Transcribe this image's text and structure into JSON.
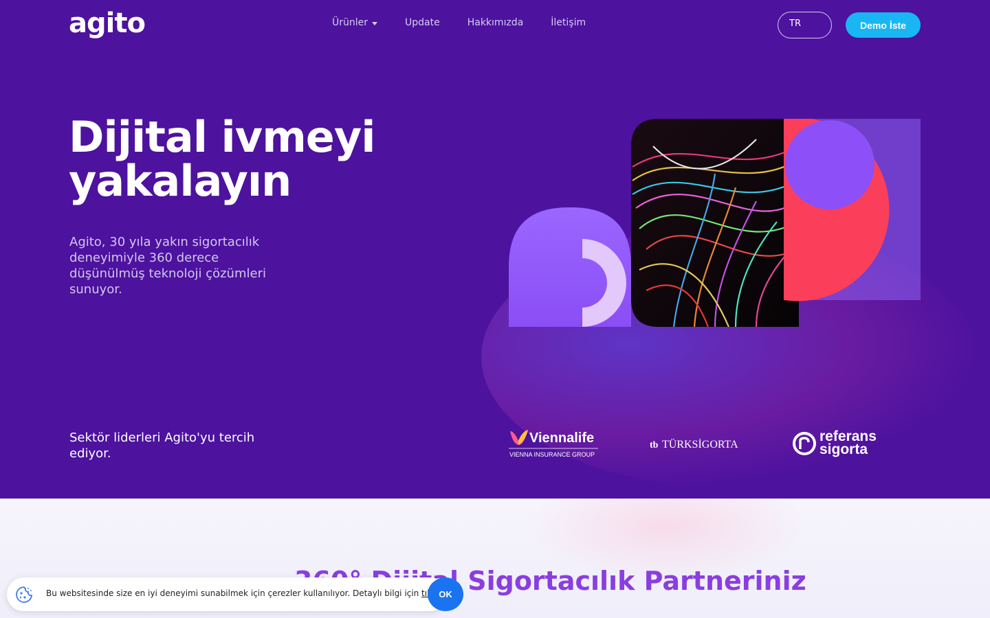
{
  "header": {
    "logo_text": "agito",
    "nav": [
      {
        "label": "Ürünler",
        "has_dropdown": true
      },
      {
        "label": "Update"
      },
      {
        "label": "Hakkımızda"
      },
      {
        "label": "İletişim"
      }
    ],
    "language": "TR",
    "cta_label": "Demo İste"
  },
  "hero": {
    "title_line1": "Dijital ivmeyi",
    "title_line2": "yakalayın",
    "description": "Agito, 30 yıla yakın sigortacılık deneyimiyle 360 derece düşünülmüş teknoloji çözümleri sunuyor.",
    "leaders_text": "Sektör liderleri Agito'yu tercih ediyor."
  },
  "partners": {
    "viennalife": {
      "name": "Viennalife",
      "sub": "VIENNA INSURANCE GROUP"
    },
    "turk": {
      "mark": "tb",
      "name": "TÜRKSİGORTA"
    },
    "referans": {
      "line1": "referans",
      "line2": "sigorta"
    }
  },
  "section": {
    "title": "360° Dijital Sigortacılık Partneriniz"
  },
  "cookie": {
    "text": "Bu websitesinde size en iyi deneyimi sunabilmek için çerezler kullanılıyor. Detaylı bilgi için ",
    "link_label": "tıklayın",
    "suffix": ".",
    "ok_label": "OK"
  },
  "colors": {
    "hero_bg": "#4d129e",
    "accent_blue": "#19b6f3",
    "accent_purple": "#8a3ee0",
    "accent_red": "#fb3f5a",
    "ok_blue": "#1a73f0"
  },
  "icons": [
    "chevron-down-icon",
    "cookie-icon"
  ]
}
